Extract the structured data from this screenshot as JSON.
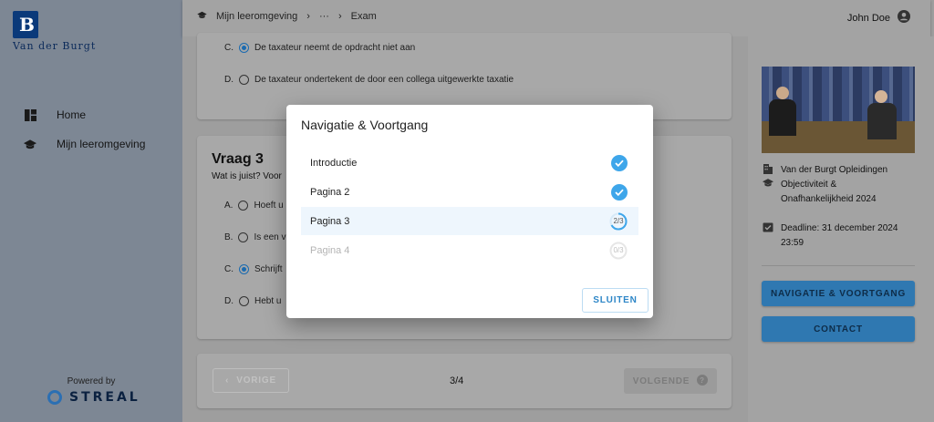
{
  "brand": {
    "logo_letter": "B",
    "logo_text": "Van der Burgt"
  },
  "sidebar": {
    "items": [
      {
        "label": "Home",
        "icon": "dashboard-icon"
      },
      {
        "label": "Mijn leeromgeving",
        "icon": "graduation-cap-icon"
      }
    ],
    "powered_by": "Powered by",
    "streal": "STREAL"
  },
  "topbar": {
    "crumbs": [
      "Mijn leeromgeving",
      "···",
      "Exam"
    ],
    "user": "John Doe"
  },
  "question_prev": {
    "options": [
      {
        "letter": "C.",
        "text": "De taxateur neemt de opdracht niet aan",
        "selected": true
      },
      {
        "letter": "D.",
        "text": "De taxateur ondertekent de door een collega uitgewerkte taxatie",
        "selected": false
      }
    ]
  },
  "question3": {
    "title": "Vraag 3",
    "prompt": "Wat is juist? Voor",
    "options": [
      {
        "letter": "A.",
        "text": "Hoeft u",
        "selected": false
      },
      {
        "letter": "B.",
        "text": "Is een v",
        "selected": false
      },
      {
        "letter": "C.",
        "text": "Schrijft",
        "selected": true
      },
      {
        "letter": "D.",
        "text": "Hebt u",
        "selected": false
      }
    ]
  },
  "pager": {
    "prev": "VORIGE",
    "count": "3/4",
    "next": "VOLGENDE"
  },
  "panel": {
    "org": "Van der Burgt Opleidingen",
    "course": "Objectiviteit & Onafhankelijkheid 2024",
    "course_line1": "Objectiviteit &",
    "course_line2": "Onafhankelijkheid 2024",
    "deadline_line1": "Deadline: 31 december 2024",
    "deadline_line2": "23:59",
    "nav_button": "NAVIGATIE & VOORTGANG",
    "contact_button": "CONTACT"
  },
  "modal": {
    "title": "Navigatie & Voortgang",
    "rows": [
      {
        "label": "Introductie",
        "status": "done"
      },
      {
        "label": "Pagina 2",
        "status": "done"
      },
      {
        "label": "Pagina 3",
        "status": "progress",
        "progress": "2/3",
        "fraction": 0.667
      },
      {
        "label": "Pagina 4",
        "status": "locked",
        "progress": "0/3",
        "fraction": 0
      }
    ],
    "close_button": "SLUITEN"
  },
  "colors": {
    "accent": "#3ea6ea",
    "overlay_button": "#2f8fd0",
    "active_row": "#eef6fd"
  }
}
